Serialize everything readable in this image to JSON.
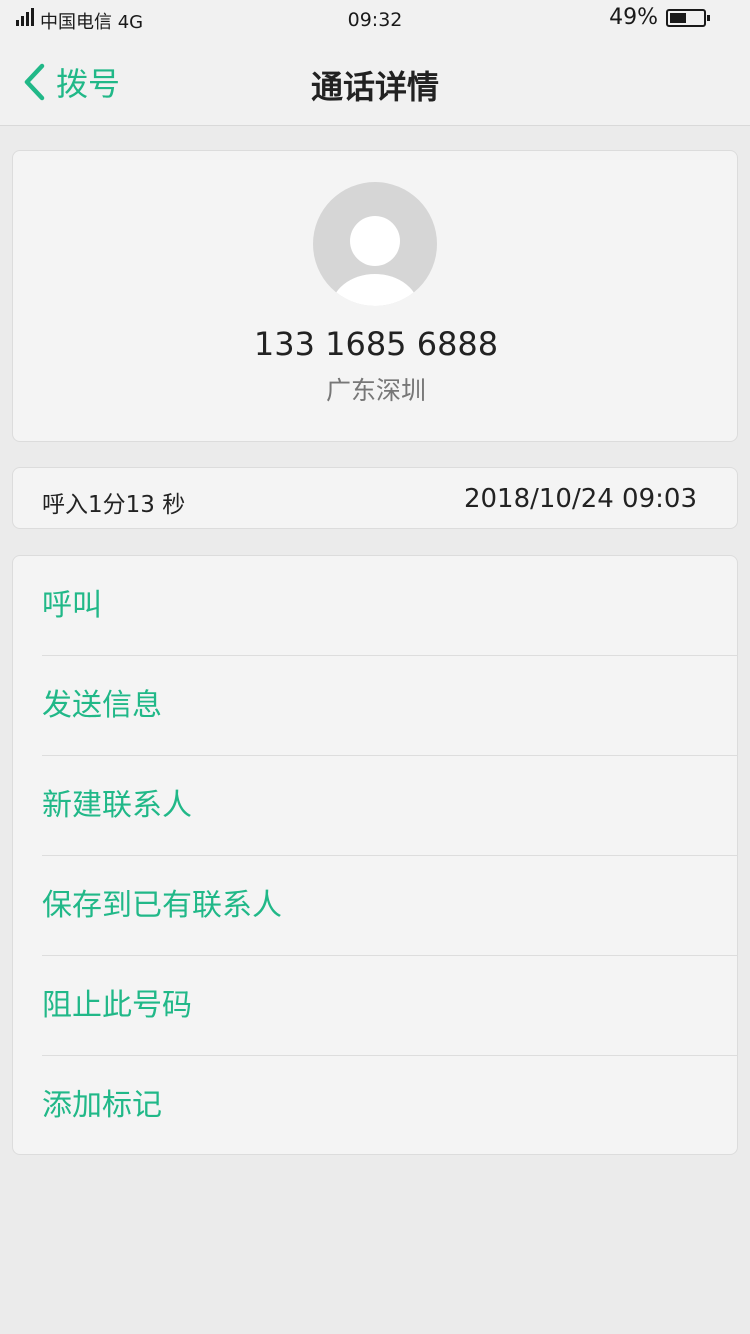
{
  "status_bar": {
    "carrier": "中国电信 4G",
    "time": "09:32",
    "battery_percent": "49%",
    "battery_level": 0.49
  },
  "nav": {
    "back_label": "拨号",
    "title": "通话详情"
  },
  "contact": {
    "number": "133 1685 6888",
    "location": "广东深圳"
  },
  "call": {
    "type": "呼入1分13 秒",
    "datetime": "2018/10/24 09:03"
  },
  "actions": [
    {
      "label": "呼叫"
    },
    {
      "label": "发送信息"
    },
    {
      "label": "新建联系人"
    },
    {
      "label": "保存到已有联系人"
    },
    {
      "label": "阻止此号码"
    },
    {
      "label": "添加标记"
    }
  ],
  "colors": {
    "accent": "#21b888",
    "background": "#ebebeb",
    "card": "#f4f4f4"
  }
}
